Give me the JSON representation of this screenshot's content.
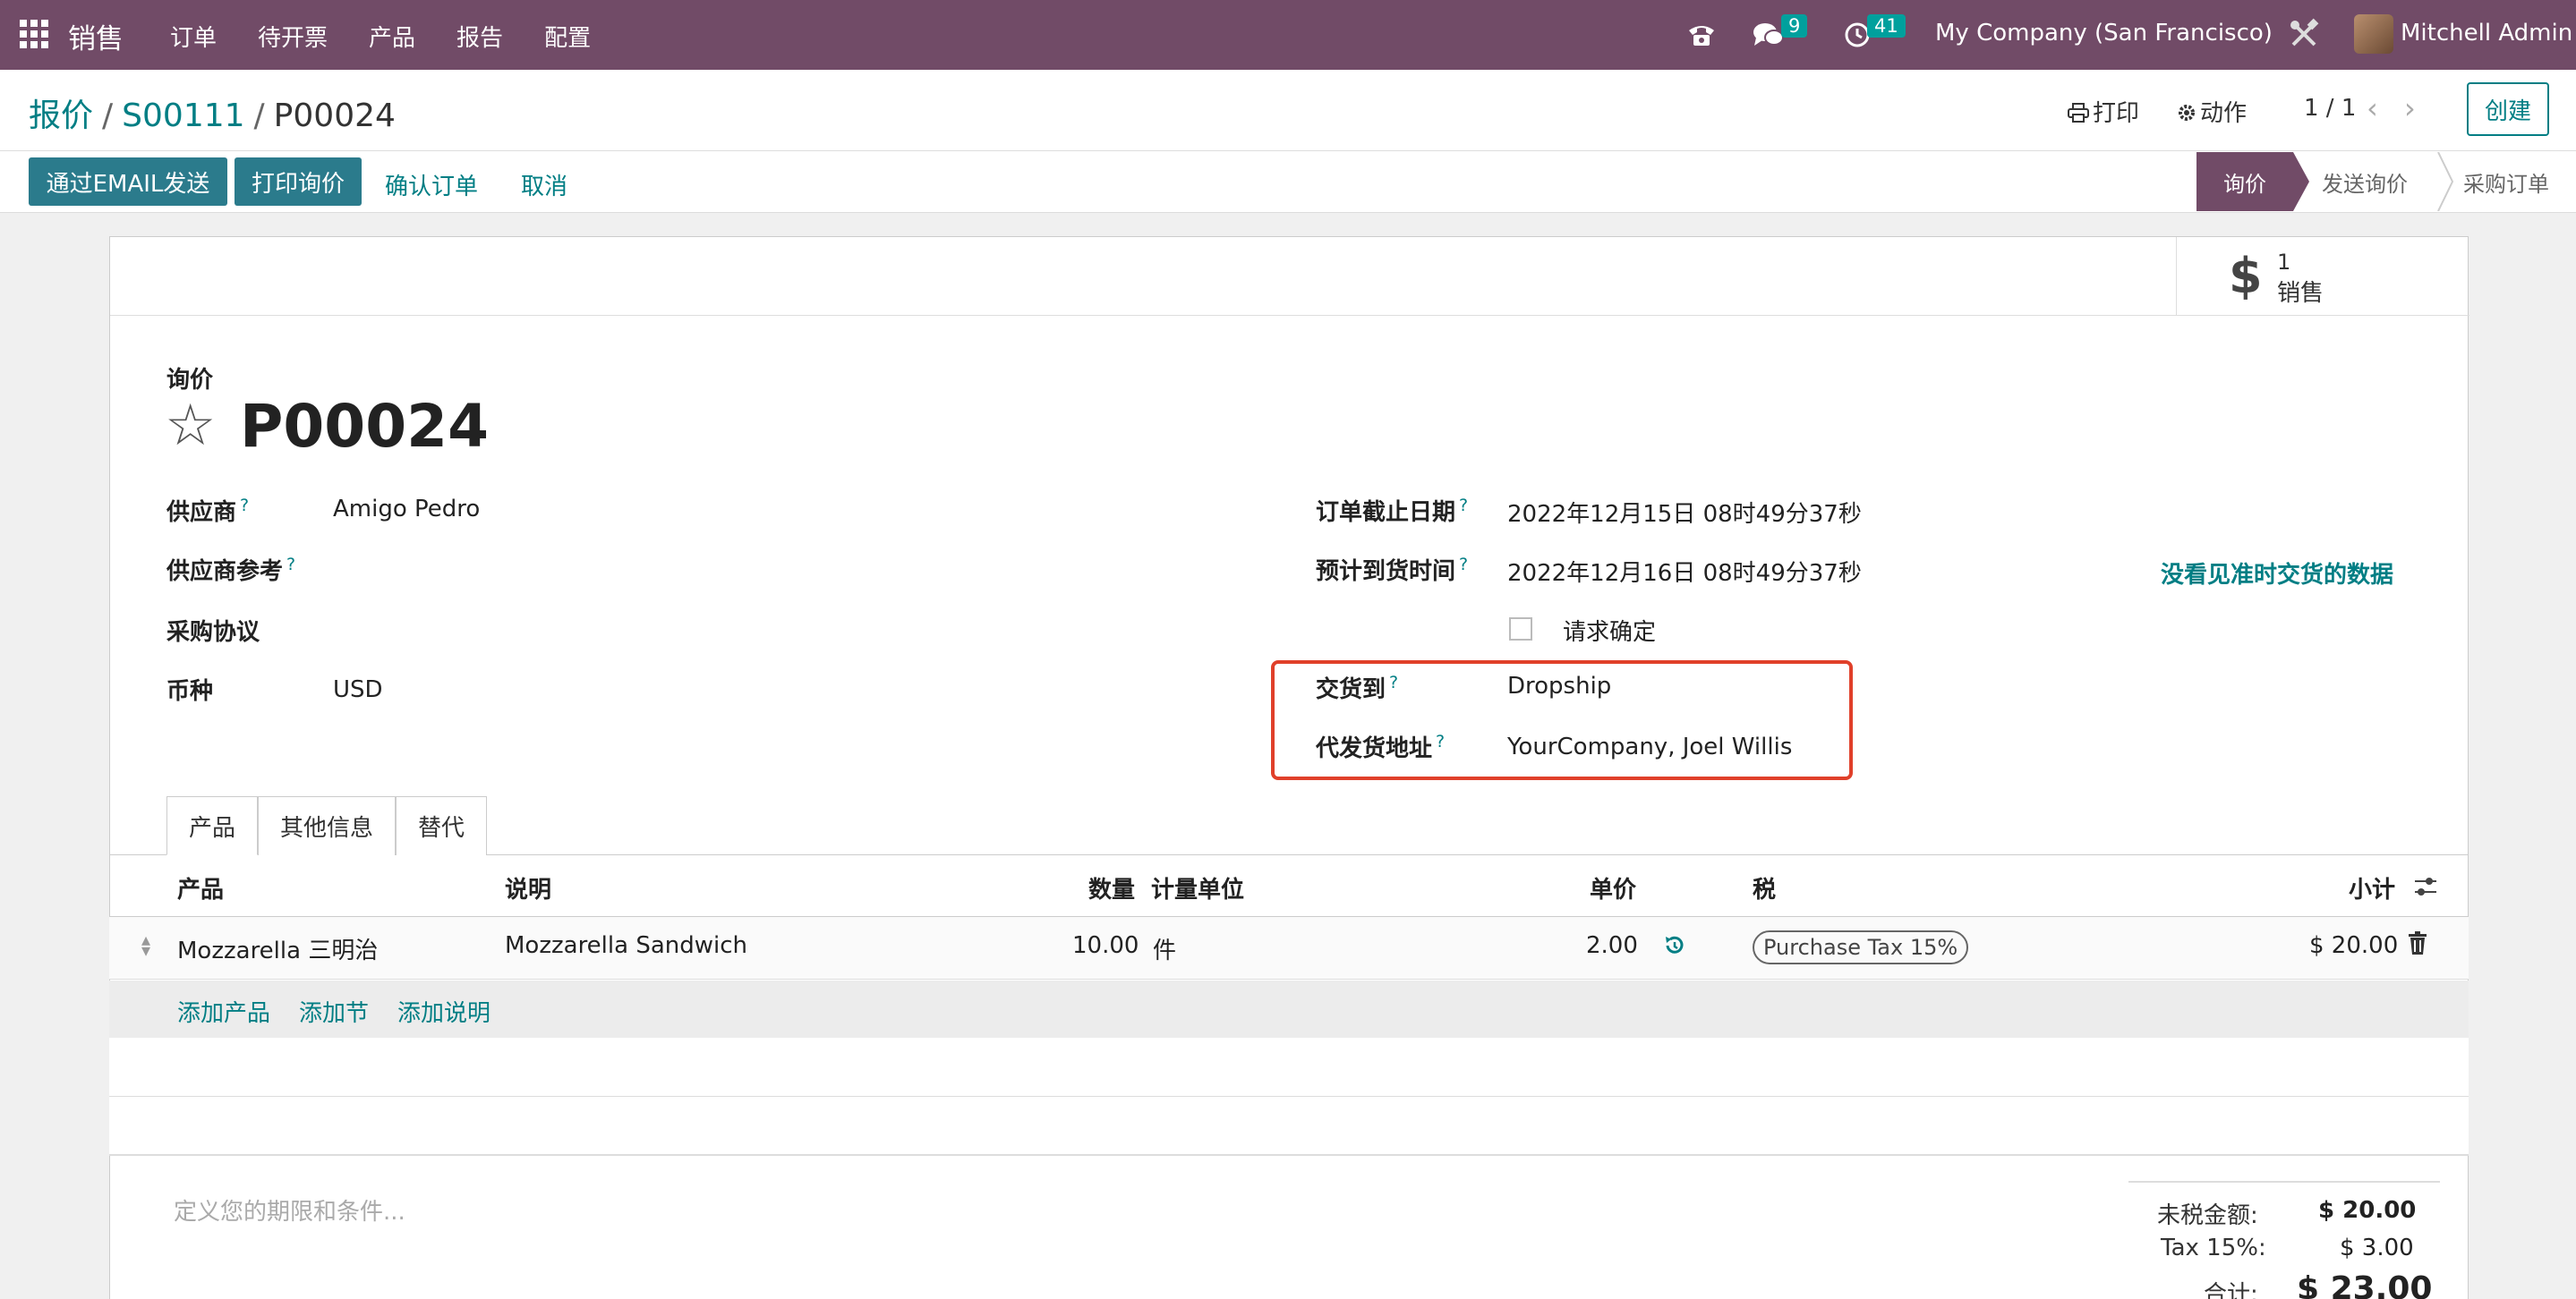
{
  "navbar": {
    "app_name": "销售",
    "menu": [
      "订单",
      "待开票",
      "产品",
      "报告",
      "配置"
    ],
    "messages_count": "9",
    "activities_count": "41",
    "company": "My Company (San Francisco)",
    "user": "Mitchell Admin",
    "colors": {
      "bar": "#714b67",
      "badge": "#00a09d"
    }
  },
  "breadcrumb": {
    "items": [
      "报价",
      "S00111",
      "P00024"
    ],
    "separator": "/"
  },
  "toolbar": {
    "print": "打印",
    "action": "动作",
    "pager": "1 / 1",
    "create": "创建"
  },
  "header_buttons": {
    "send_email": "通过EMAIL发送",
    "print_rfq": "打印询价",
    "confirm": "确认订单",
    "cancel": "取消"
  },
  "statusbar": {
    "stages": [
      "询价",
      "发送询价",
      "采购订单"
    ],
    "active": "询价"
  },
  "smart_button": {
    "value": "1",
    "label": "销售",
    "icon": "dollar-icon"
  },
  "form": {
    "doc_type": "询价",
    "name": "P00024",
    "left_fields": [
      {
        "label": "供应商",
        "help": "?",
        "value": "Amigo Pedro"
      },
      {
        "label": "供应商参考",
        "help": "?",
        "value": ""
      },
      {
        "label": "采购协议",
        "help": "",
        "value": ""
      },
      {
        "label": "币种",
        "help": "",
        "value": "USD"
      }
    ],
    "right_fields": [
      {
        "label": "订单截止日期",
        "help": "?",
        "value": "2022年12月15日 08时49分37秒"
      },
      {
        "label": "预计到货时间",
        "help": "?",
        "value": "2022年12月16日 08时49分37秒"
      },
      {
        "label": "交货到",
        "help": "?",
        "value": "Dropship"
      },
      {
        "label": "代发货地址",
        "help": "?",
        "value": "YourCompany, Joel Willis"
      }
    ],
    "request_confirm": "请求确定",
    "ontime_link": "没看见准时交货的数据"
  },
  "tabs": [
    "产品",
    "其他信息",
    "替代"
  ],
  "table": {
    "headers": {
      "product": "产品",
      "description": "说明",
      "qty": "数量",
      "uom": "计量单位",
      "price": "单价",
      "tax": "税",
      "subtotal": "小计"
    },
    "rows": [
      {
        "product": "Mozzarella 三明治",
        "description": "Mozzarella Sandwich",
        "qty": "10.00",
        "uom": "件",
        "price": "2.00",
        "tax": "Purchase Tax 15%",
        "subtotal": "$ 20.00"
      }
    ],
    "add_links": [
      "添加产品",
      "添加节",
      "添加说明"
    ]
  },
  "footer": {
    "terms_placeholder": "定义您的期限和条件...",
    "untaxed_label": "未税金额:",
    "untaxed_value": "$ 20.00",
    "tax_label": "Tax 15%:",
    "tax_value": "$ 3.00",
    "total_label": "合计:",
    "total_value": "$ 23.00"
  }
}
